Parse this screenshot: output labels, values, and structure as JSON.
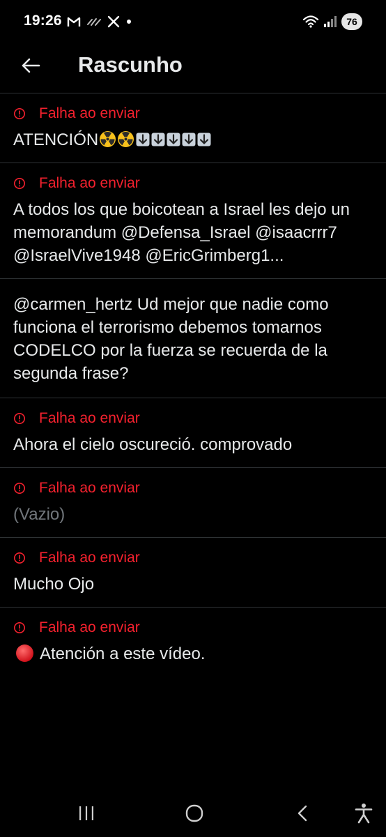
{
  "status_bar": {
    "time": "19:26",
    "battery": "76",
    "left_icons": [
      "gmail-icon",
      "signal-strength-icon",
      "x-logo-icon",
      "dot-icon"
    ],
    "right_icons": [
      "wifi-icon",
      "cell-signal-icon",
      "battery-icon"
    ]
  },
  "header": {
    "title": "Rascunho",
    "back_icon": "arrow-left-icon"
  },
  "colors": {
    "background": "#000000",
    "text": "#e7e9ea",
    "error": "#f4212e",
    "muted": "#71767b",
    "divider": "#2f3336"
  },
  "drafts": [
    {
      "failed": true,
      "status": "Falha ao enviar",
      "text": "ATENCIÓN",
      "trailing_emoji": [
        "radiation",
        "radiation",
        "down-arrow",
        "down-arrow",
        "down-arrow",
        "down-arrow",
        "down-arrow"
      ]
    },
    {
      "failed": true,
      "status": "Falha ao enviar",
      "text": "A todos los que boicotean a Israel les dejo un memorandum @Defensa_Israel @isaacrrr7 @IsraelVive1948 @EricGrimberg1..."
    },
    {
      "failed": false,
      "text": "@carmen_hertz Ud mejor que nadie como funciona el terrorismo debemos tomarnos CODELCO por la fuerza se recuerda de la segunda frase?"
    },
    {
      "failed": true,
      "status": "Falha ao enviar",
      "text": "Ahora el cielo oscureció. comprovado"
    },
    {
      "failed": true,
      "status": "Falha ao enviar",
      "text": "(Vazio)",
      "empty": true
    },
    {
      "failed": true,
      "status": "Falha ao enviar",
      "text": "Mucho Ojo"
    },
    {
      "failed": true,
      "status": "Falha ao enviar",
      "text": "Atención a este vídeo.",
      "leading_emoji": "red-circle"
    }
  ],
  "nav_bar": {
    "buttons": [
      "recent-apps-icon",
      "home-icon",
      "back-nav-icon",
      "accessibility-icon"
    ]
  }
}
